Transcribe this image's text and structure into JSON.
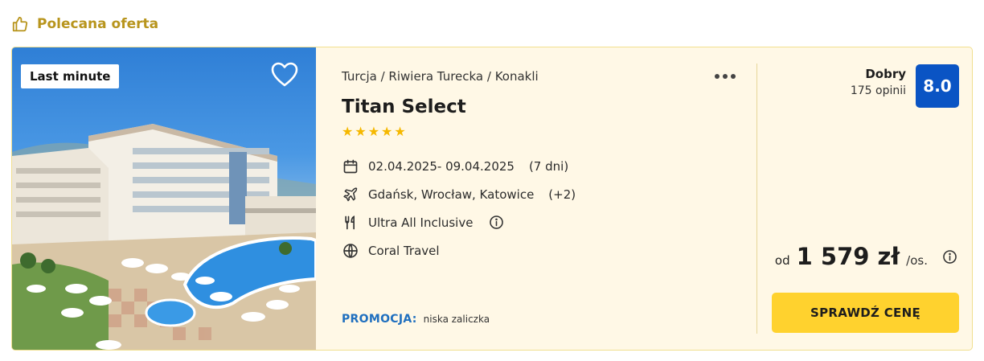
{
  "featured": {
    "label": "Polecana oferta",
    "icon": "thumbs-up-icon"
  },
  "offer": {
    "badge": "Last minute",
    "location": "Turcja / Riwiera Turecka / Konakli",
    "hotel_name": "Titan Select",
    "stars": 5,
    "dates": "02.04.2025- 09.04.2025",
    "duration": "(7 dni)",
    "airports": "Gdańsk, Wrocław, Katowice",
    "airports_extra": "(+2)",
    "board": "Ultra All Inclusive",
    "operator": "Coral Travel",
    "promo_label": "PROMOCJA:",
    "promo_text": "niska zaliczka"
  },
  "rating": {
    "label": "Dobry",
    "count": "175 opinii",
    "score": "8.0",
    "color": "#0a54c4"
  },
  "price": {
    "prefix": "od",
    "amount": "1 579 zł",
    "suffix": "/os."
  },
  "cta_label": "SPRAWDŹ CENĘ",
  "colors": {
    "accent_gold": "#b8951d",
    "card_background": "#fff8e6",
    "cta_background": "#ffd22e",
    "promo_blue": "#1f6fbf",
    "stars": "#f5b800"
  }
}
